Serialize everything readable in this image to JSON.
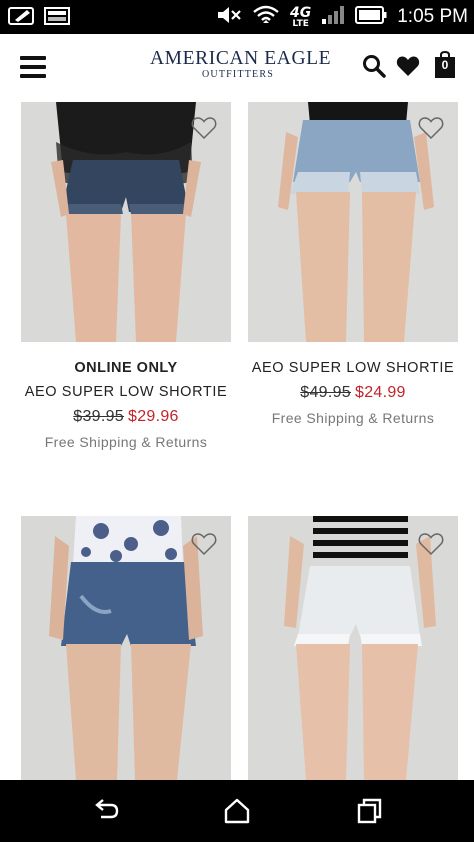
{
  "status_bar": {
    "time": "1:05 PM",
    "network": "4G",
    "network_sub": "LTE",
    "battery_icon": "battery-icon",
    "signal_icon": "signal-icon",
    "wifi_icon": "wifi-icon",
    "mute_icon": "volume-mute-icon"
  },
  "header": {
    "brand": "AMERICAN EAGLE",
    "brand_sub": "OUTFITTERS",
    "bag_count": "0"
  },
  "products": [
    {
      "tag": "ONLINE ONLY",
      "name": "AEO SUPER LOW SHORTIE",
      "old_price": "$39.95",
      "sale_price": "$29.96",
      "shipping": "Free Shipping & Returns"
    },
    {
      "tag": "",
      "name": "AEO SUPER LOW SHORTIE",
      "old_price": "$49.95",
      "sale_price": "$24.99",
      "shipping": "Free Shipping & Returns"
    },
    {
      "tag": "",
      "name": "",
      "old_price": "",
      "sale_price": "",
      "shipping": ""
    },
    {
      "tag": "",
      "name": "",
      "old_price": "",
      "sale_price": "",
      "shipping": ""
    }
  ],
  "colors": {
    "brand_navy": "#1c2a4a",
    "sale_red": "#c3232b",
    "muted_gray": "#777777"
  }
}
